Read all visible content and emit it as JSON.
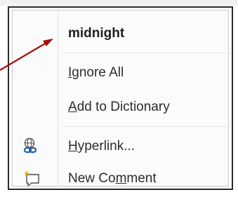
{
  "context_menu": {
    "suggestion": "midnight",
    "items": [
      {
        "label": "Ignore All",
        "mnemonic_index": 0
      },
      {
        "label": "Add to Dictionary",
        "mnemonic_index": 0
      },
      {
        "label": "Hyperlink...",
        "mnemonic_index": 0,
        "icon": "hyperlink-icon"
      },
      {
        "label": "New Comment",
        "mnemonic_index": 6,
        "icon": "new-comment-icon"
      }
    ]
  },
  "colors": {
    "arrow": "#a50d0d",
    "border": "#2b2b2b",
    "hyperlink_icon": "#1f5fb0",
    "comment_icon_accent": "#e8b100"
  }
}
